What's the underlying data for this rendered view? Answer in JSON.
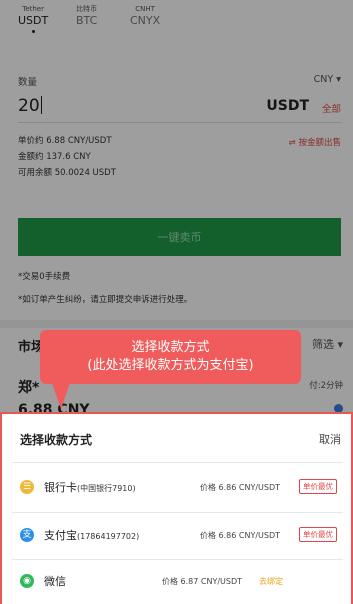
{
  "currency_tabs": [
    {
      "sub": "Tether",
      "label": "USDT"
    },
    {
      "sub": "比特币",
      "label": "BTC"
    },
    {
      "sub": "CNHT",
      "label": "CNYX"
    }
  ],
  "form": {
    "quantity_label": "数量",
    "unit_select": "CNY ▾",
    "quantity_value": "20",
    "coin": "USDT",
    "all_label": "全部",
    "unit_price": "单价约 6.88 CNY/USDT",
    "amount": "金额约 137.6 CNY",
    "balance": "可用余额 50.0024 USDT",
    "by_amount_label": "⇌ 按金额出售",
    "sell_button": "一键卖币",
    "note1": "*交易0手续费",
    "note2": "*如订单产生纠纷，请立即提交申诉进行处理。"
  },
  "market": {
    "title": "市场",
    "filter": "筛选 ▾",
    "merchant": "郑*",
    "time": "付:2分钟",
    "price_peek": "6.88 CNY"
  },
  "callout": {
    "line1": "选择收款方式",
    "line2": "(此处选择收款方式为支付宝)"
  },
  "sheet": {
    "title": "选择收款方式",
    "cancel": "取消",
    "methods": [
      {
        "icon": "☰",
        "name": "银行卡",
        "detail": "(中国银行7910)",
        "price": "价格 6.86 CNY/USDT",
        "tag": "单价最优",
        "color": "#f0b83a"
      },
      {
        "icon": "支",
        "name": "支付宝",
        "detail": "(17864197702)",
        "price": "价格 6.86 CNY/USDT",
        "tag": "单价最优",
        "color": "#2d8fe6"
      },
      {
        "icon": "◉",
        "name": "微信",
        "detail": "",
        "price": "价格 6.87 CNY/USDT",
        "action": "去绑定",
        "color": "#2fb85a"
      }
    ]
  }
}
